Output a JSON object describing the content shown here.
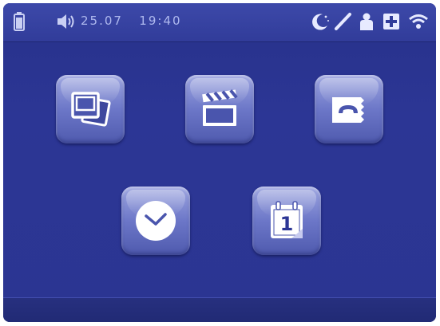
{
  "status_bar": {
    "date": "25.07",
    "time": "19:40",
    "icons": [
      "battery-icon",
      "speaker-icon",
      "night-mode-icon",
      "pen-icon",
      "person-icon",
      "plus-icon",
      "wifi-icon"
    ]
  },
  "home_icons": [
    {
      "name": "photo-album-icon"
    },
    {
      "name": "clapperboard-icon"
    },
    {
      "name": "phone-icon"
    },
    {
      "name": "clock-icon"
    },
    {
      "name": "calendar-icon"
    }
  ],
  "calendar_day": "1",
  "colors": {
    "screen": "#2c3695",
    "status_bar": "#3d49a9",
    "icon_tile": "#6c77c8",
    "glyph": "#ffffff"
  }
}
